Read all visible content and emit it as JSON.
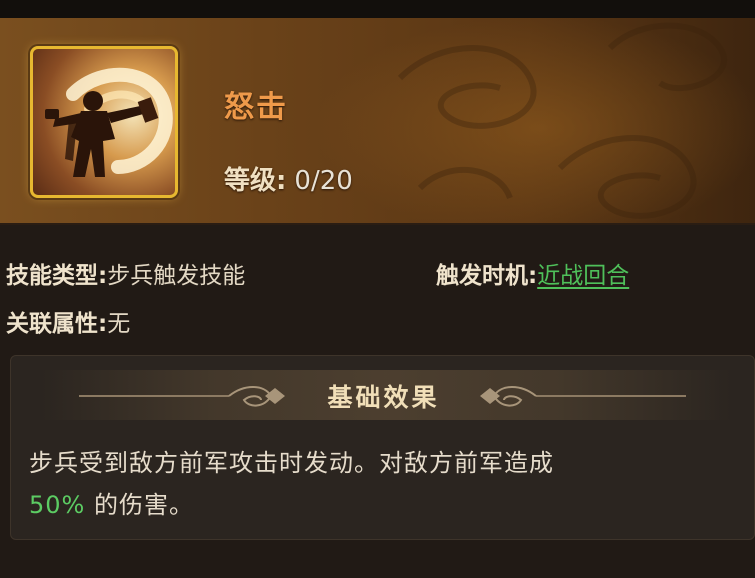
{
  "skill": {
    "name": "怒击",
    "level_label": "等级:",
    "level_value": "0/20",
    "icon_name": "warrior-strike-icon"
  },
  "info": {
    "type_label": "技能类型:",
    "type_value": "步兵触发技能",
    "trigger_label": "触发时机:",
    "trigger_value": "近战回合",
    "attr_label": "关联属性:",
    "attr_value": "无"
  },
  "effect": {
    "title": "基础效果",
    "text_part1": "步兵受到敌方前军攻击时发动。对敌方前军造成",
    "percent": "50%",
    "text_part2": " 的伤害。"
  },
  "colors": {
    "skill_name": "#ef9a4a",
    "link_green": "#4fc05a",
    "percent_green": "#5ccc63",
    "icon_border": "#e7b830"
  }
}
